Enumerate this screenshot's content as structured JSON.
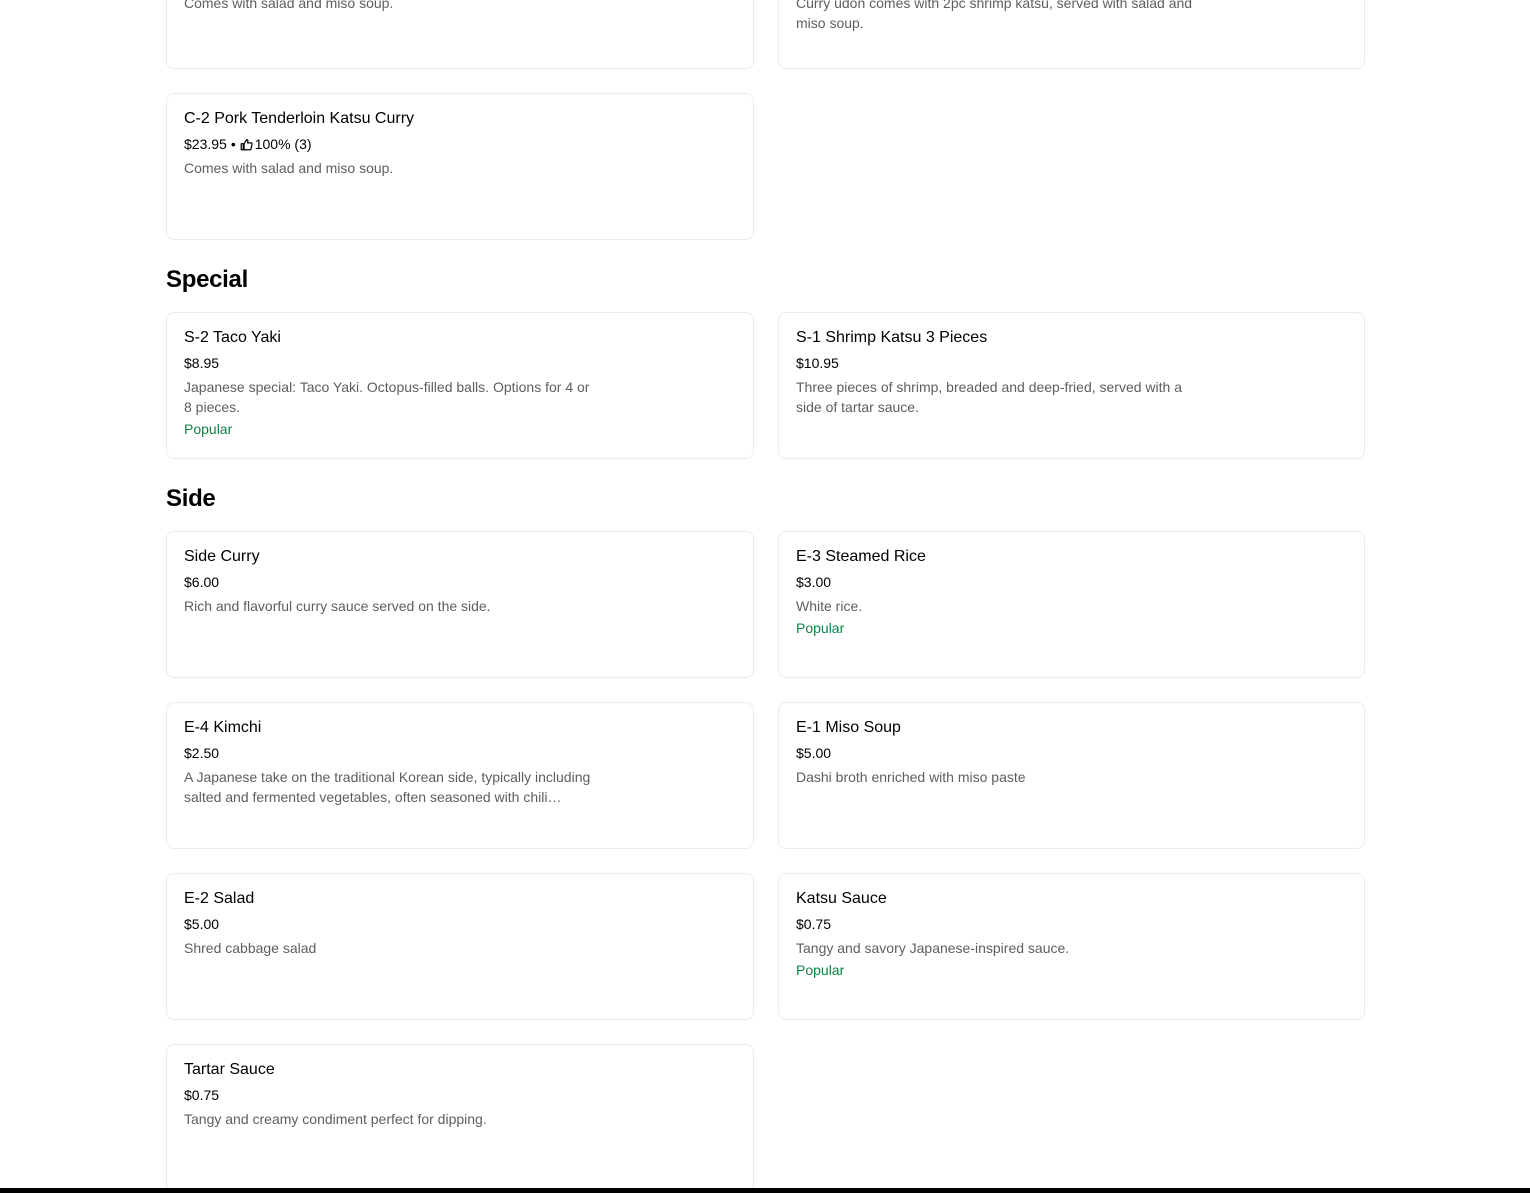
{
  "top_cards": {
    "left_desc": "Comes with salad and miso soup.",
    "right_desc": "Curry udon comes with 2pc shrimp katsu, served with salad and miso soup."
  },
  "curry_items": [
    {
      "title": "C-2 Pork Tenderloin Katsu Curry",
      "price": "$23.95",
      "separator": "•",
      "rating": "100% (3)",
      "desc": "Comes with salad and miso soup."
    }
  ],
  "sections": {
    "special": "Special",
    "side": "Side"
  },
  "special_items": [
    {
      "title": "S-2 Taco Yaki",
      "price": "$8.95",
      "desc": "Japanese special: Taco Yaki. Octopus-filled balls. Options for 4 or 8 pieces.",
      "badge": "Popular"
    },
    {
      "title": "S-1 Shrimp Katsu 3 Pieces",
      "price": "$10.95",
      "desc": "Three pieces of shrimp, breaded and deep-fried, served with a side of tartar sauce."
    }
  ],
  "side_items": [
    {
      "title": "Side Curry",
      "price": "$6.00",
      "desc": "Rich and flavorful curry sauce served on the side."
    },
    {
      "title": "E-3 Steamed Rice",
      "price": "$3.00",
      "desc": "White rice.",
      "badge": "Popular"
    },
    {
      "title": "E-4 Kimchi",
      "price": "$2.50",
      "desc": "A Japanese take on the traditional Korean side, typically including salted and fermented vegetables, often seasoned with chili pepper and garlic."
    },
    {
      "title": "E-1 Miso Soup",
      "price": "$5.00",
      "desc": "Dashi broth enriched with miso paste"
    },
    {
      "title": "E-2 Salad",
      "price": "$5.00",
      "desc": "Shred cabbage salad"
    },
    {
      "title": "Katsu Sauce",
      "price": "$0.75",
      "desc": "Tangy and savory Japanese-inspired sauce.",
      "badge": "Popular"
    },
    {
      "title": "Tartar Sauce",
      "price": "$0.75",
      "desc": "Tangy and creamy condiment perfect for dipping."
    }
  ],
  "colors": {
    "popular_badge": "#0e8345",
    "description_text": "#5e5e5e",
    "card_border": "#ececec"
  }
}
